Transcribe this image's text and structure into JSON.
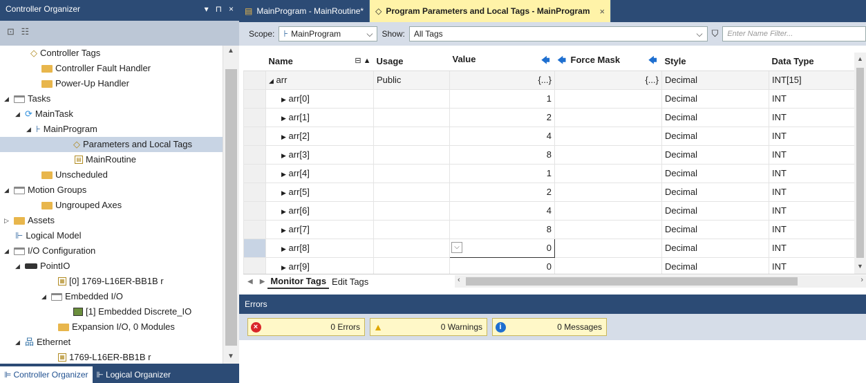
{
  "organizer": {
    "title": "Controller Organizer",
    "controls": [
      "▾",
      "⊓",
      "×"
    ],
    "tree": [
      {
        "label": "Controller Tags",
        "icon": "tag-icon"
      },
      {
        "label": "Controller Fault Handler",
        "icon": "folder-icon"
      },
      {
        "label": "Power-Up Handler",
        "icon": "folder-icon"
      },
      {
        "label": "Tasks",
        "icon": "open-folder-icon"
      },
      {
        "label": "MainTask",
        "icon": "task-icon"
      },
      {
        "label": "MainProgram",
        "icon": "program-icon"
      },
      {
        "label": "Parameters and Local Tags",
        "icon": "tag-icon"
      },
      {
        "label": "MainRoutine",
        "icon": "routine-icon"
      },
      {
        "label": "Unscheduled",
        "icon": "folder-icon"
      },
      {
        "label": "Motion Groups",
        "icon": "open-folder-icon"
      },
      {
        "label": "Ungrouped Axes",
        "icon": "folder-icon"
      },
      {
        "label": "Assets",
        "icon": "folder-icon"
      },
      {
        "label": "Logical Model",
        "icon": "logical-model-icon"
      },
      {
        "label": "I/O Configuration",
        "icon": "open-folder-icon"
      },
      {
        "label": "PointIO",
        "icon": "chassis-icon"
      },
      {
        "label": "[0] 1769-L16ER-BB1B r",
        "icon": "module-icon"
      },
      {
        "label": "Embedded I/O",
        "icon": "open-folder-icon"
      },
      {
        "label": "[1] Embedded Discrete_IO",
        "icon": "io-module-icon"
      },
      {
        "label": "Expansion I/O, 0 Modules",
        "icon": "folder-icon"
      },
      {
        "label": "Ethernet",
        "icon": "network-icon"
      },
      {
        "label": "1769-L16ER-BB1B r",
        "icon": "module-icon"
      }
    ],
    "tabs": [
      "Controller Organizer",
      "Logical Organizer"
    ]
  },
  "doc_tabs": [
    {
      "label": "MainProgram - MainRoutine*"
    },
    {
      "label": "Program Parameters and Local Tags - MainProgram"
    }
  ],
  "scope": {
    "scope_label": "Scope:",
    "scope_value": "MainProgram",
    "show_label": "Show:",
    "show_value": "All Tags",
    "filter_placeholder": "Enter Name Filter..."
  },
  "grid": {
    "columns": [
      "Name",
      "Usage",
      "Value",
      "Force Mask",
      "Style",
      "Data Type"
    ],
    "rows": [
      {
        "name": "arr",
        "usage": "Public",
        "value": "{...}",
        "force": "{...}",
        "style": "Decimal",
        "type": "INT[15]"
      },
      {
        "name": "arr[0]",
        "usage": "",
        "value": "1",
        "force": "",
        "style": "Decimal",
        "type": "INT"
      },
      {
        "name": "arr[1]",
        "usage": "",
        "value": "2",
        "force": "",
        "style": "Decimal",
        "type": "INT"
      },
      {
        "name": "arr[2]",
        "usage": "",
        "value": "4",
        "force": "",
        "style": "Decimal",
        "type": "INT"
      },
      {
        "name": "arr[3]",
        "usage": "",
        "value": "8",
        "force": "",
        "style": "Decimal",
        "type": "INT"
      },
      {
        "name": "arr[4]",
        "usage": "",
        "value": "1",
        "force": "",
        "style": "Decimal",
        "type": "INT"
      },
      {
        "name": "arr[5]",
        "usage": "",
        "value": "2",
        "force": "",
        "style": "Decimal",
        "type": "INT"
      },
      {
        "name": "arr[6]",
        "usage": "",
        "value": "4",
        "force": "",
        "style": "Decimal",
        "type": "INT"
      },
      {
        "name": "arr[7]",
        "usage": "",
        "value": "8",
        "force": "",
        "style": "Decimal",
        "type": "INT"
      },
      {
        "name": "arr[8]",
        "usage": "",
        "value": "0",
        "force": "",
        "style": "Decimal",
        "type": "INT"
      },
      {
        "name": "arr[9]",
        "usage": "",
        "value": "0",
        "force": "",
        "style": "Decimal",
        "type": "INT"
      }
    ],
    "sheet_tabs": [
      "Monitor Tags",
      "Edit Tags"
    ]
  },
  "errors": {
    "title": "Errors",
    "errors_label": "0 Errors",
    "warnings_label": "0 Warnings",
    "messages_label": "0 Messages"
  },
  "colors": {
    "chrome": "#2c4b75",
    "active_tab": "#fff3a8",
    "selection": "#c8d4e4"
  }
}
